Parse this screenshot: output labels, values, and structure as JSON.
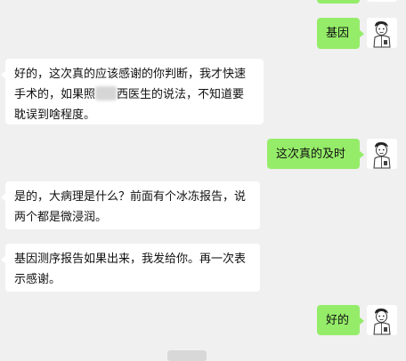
{
  "messages": [
    {
      "side": "out",
      "text": "基因"
    },
    {
      "side": "in",
      "text_before": "好的，这次真的应该感谢的你判断，我才快速手术的，如果照",
      "text_after": "西医生的说法，不知道要耽误到啥程度。"
    },
    {
      "side": "out",
      "text": "这次真的及时"
    },
    {
      "side": "in",
      "text": "是的，大病理是什么？前面有个冰冻报告，说两个都是微浸润。"
    },
    {
      "side": "in",
      "text": "基因测序报告如果出来，我发给你。再一次表示感谢。"
    },
    {
      "side": "out",
      "text": "好的"
    }
  ],
  "colors": {
    "outgoing": "#95ec69",
    "incoming": "#ffffff",
    "background": "#f0f0f0"
  },
  "icons": {
    "avatar": "cartoon-doctor-avatar"
  }
}
